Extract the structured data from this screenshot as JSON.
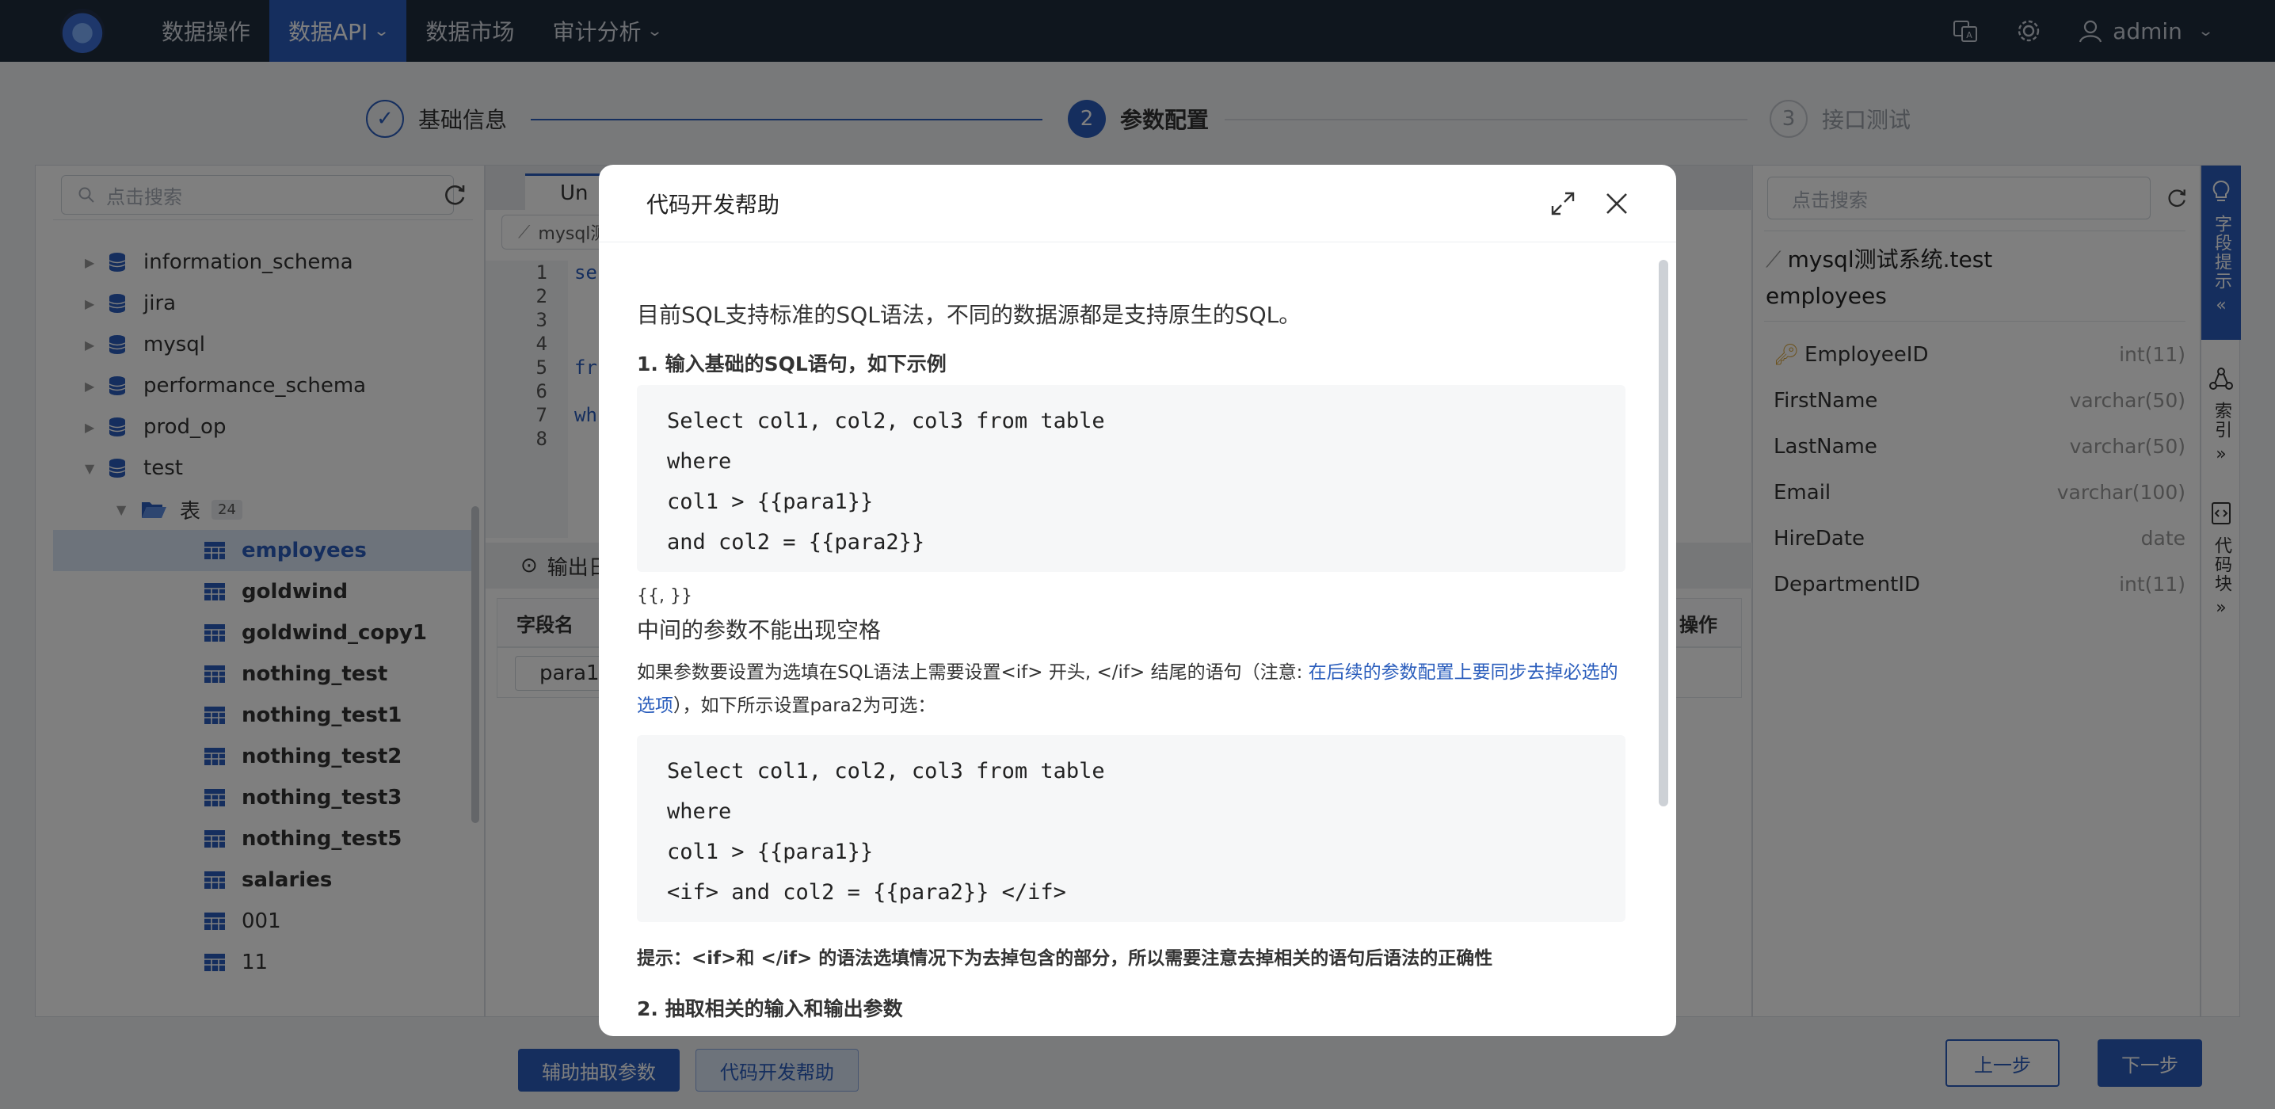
{
  "nav": {
    "items": [
      {
        "label": "数据操作"
      },
      {
        "label": "数据API"
      },
      {
        "label": "数据市场"
      },
      {
        "label": "审计分析"
      }
    ],
    "user": "admin"
  },
  "steps": [
    {
      "num": "✓",
      "label": "基础信息"
    },
    {
      "num": "2",
      "label": "参数配置"
    },
    {
      "num": "3",
      "label": "接口测试"
    }
  ],
  "left": {
    "search_placeholder": "点击搜索",
    "databases": [
      "information_schema",
      "jira",
      "mysql",
      "performance_schema",
      "prod_op",
      "test"
    ],
    "folder": {
      "label": "表",
      "count": "24"
    },
    "tables": [
      "employees",
      "goldwind",
      "goldwind_copy1",
      "nothing_test",
      "nothing_test1",
      "nothing_test2",
      "nothing_test3",
      "nothing_test5",
      "salaries",
      "001",
      "11"
    ]
  },
  "mid": {
    "tab": "Un",
    "source": "mysql测",
    "line_numbers": [
      "1",
      "2",
      "3",
      "4",
      "5",
      "6",
      "7",
      "8"
    ],
    "code": {
      "l1": "se",
      "l5": "fr",
      "l7": "wh"
    },
    "output_label": "输出日",
    "grid_col1": "字段名",
    "grid_col_last": "操作",
    "row_value": "para1"
  },
  "right": {
    "search_placeholder": "点击搜索",
    "title_line1": "mysql测试系统.test",
    "title_line2": "employees",
    "fields": [
      {
        "name": "EmployeeID",
        "type": "int(11)",
        "key": true
      },
      {
        "name": "FirstName",
        "type": "varchar(50)"
      },
      {
        "name": "LastName",
        "type": "varchar(50)"
      },
      {
        "name": "Email",
        "type": "varchar(100)"
      },
      {
        "name": "HireDate",
        "type": "date"
      },
      {
        "name": "DepartmentID",
        "type": "int(11)"
      }
    ],
    "rail": {
      "tab1": "字段提示",
      "tab2": "索引",
      "tab3": "代码块"
    }
  },
  "bottom": {
    "btn_extract": "辅助抽取参数",
    "btn_help": "代码开发帮助",
    "btn_prev": "上一步",
    "btn_next": "下一步"
  },
  "modal": {
    "title": "代码开发帮助",
    "intro": "目前SQL支持标准的SQL语法，不同的数据源都是支持原生的SQL。",
    "h1": "1. 输入基础的SQL语句，如下示例",
    "code1": [
      "Select col1, col2, col3 from table",
      "where",
      "col1 > {{para1}}",
      "and col2 = {{para2}}"
    ],
    "brace": "{{, }}",
    "no_space": "中间的参数不能出现空格",
    "optional_pre": "如果参数要设置为选填在SQL语法上需要设置<if> 开头, </if> 结尾的语句（注意: ",
    "optional_link": "在后续的参数配置上要同步去掉必选的选项",
    "optional_post": "），如下所示设置para2为可选：",
    "code2": [
      "Select col1, col2, col3 from table",
      "where",
      "col1 > {{para1}}",
      "<if> and col2 = {{para2}} </if>"
    ],
    "tip": "提示：<if>和 </if> 的语法选填情况下为去掉包含的部分，所以需要注意去掉相关的语句后语法的正确性",
    "h2": "2. 抽取相关的输入和输出参数"
  }
}
